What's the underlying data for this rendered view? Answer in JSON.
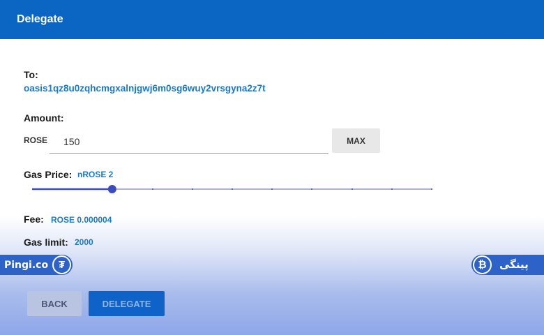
{
  "dialog": {
    "title": "Delegate"
  },
  "to": {
    "label": "To:",
    "address": "oasis1qz8u0zqhcmgxalnjgwj6m0sg6wuy2vrsgyna2z7t"
  },
  "amount": {
    "label": "Amount:",
    "currency": "ROSE",
    "value": "150",
    "max_label": "MAX"
  },
  "gas_price": {
    "label": "Gas Price:",
    "value": "nROSE 2",
    "slider_fraction": 0.2
  },
  "fee": {
    "label": "Fee:",
    "value": "ROSE 0.000004"
  },
  "gas_limit": {
    "label": "Gas limit:",
    "value": "2000"
  },
  "watermark": {
    "left_text": "Pingi.co",
    "left_icon": "tether-icon",
    "right_text": "پینگی",
    "right_icon": "bitcoin-icon"
  },
  "actions": {
    "back_label": "BACK",
    "delegate_label": "DELEGATE"
  },
  "colors": {
    "primary": "#0b66c3",
    "link": "#1b79c9",
    "slider": "#3b4cc0"
  }
}
